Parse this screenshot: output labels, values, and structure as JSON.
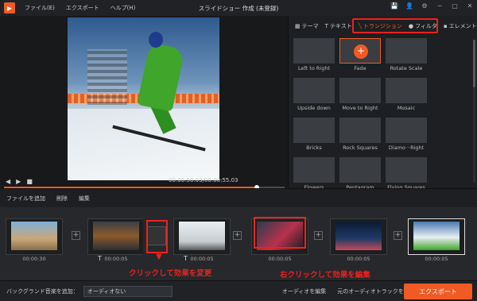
{
  "titlebar": {
    "logo": "▶",
    "menu": [
      "ファイル(E)",
      "エクスポート",
      "ヘルプ(H)"
    ],
    "title": "スライドショー 作成 (未登録)",
    "controls": [
      "💾",
      "👤",
      "⚙",
      "─",
      "▢",
      "✕"
    ]
  },
  "preview": {
    "progress_fraction": 0.9,
    "timecode": "00:00:50.03/00:00:55.03",
    "buttons": [
      "◀",
      "▶",
      "■"
    ],
    "right_icons": [
      "⊞",
      "◀",
      "⛶"
    ]
  },
  "panel": {
    "tabs": [
      {
        "icon": "▦",
        "label": "テーマ"
      },
      {
        "icon": "T",
        "label": "テキスト"
      },
      {
        "icon": "╲",
        "label": "トランジション"
      },
      {
        "icon": "●",
        "label": "フィルタ"
      },
      {
        "icon": "▪",
        "label": "エレメント"
      }
    ],
    "transitions": [
      {
        "label": "Left to Right"
      },
      {
        "label": "Fade"
      },
      {
        "label": "Rotate Scale"
      },
      {
        "label": "Upside down"
      },
      {
        "label": "Move to Right"
      },
      {
        "label": "Mosaic"
      },
      {
        "label": "Bricks"
      },
      {
        "label": "Rock Squares"
      },
      {
        "label": "Diamo···Right"
      },
      {
        "label": "Flowers"
      },
      {
        "label": "Pentagram"
      },
      {
        "label": "Flying Squares"
      }
    ]
  },
  "toolbar": {
    "add_files": "ファイルを追加",
    "delete": "削除",
    "edit": "編集"
  },
  "timeline": {
    "clips": [
      {
        "duration": "00:00:30"
      },
      {
        "duration": "00:00:05"
      },
      {
        "duration": "00:00:05"
      },
      {
        "duration": "00:00:05"
      },
      {
        "duration": "00:00:05"
      },
      {
        "duration": "00:00:05"
      }
    ],
    "annotation_left": "クリックして効果を変更",
    "annotation_right": "右クリックして効果を編集"
  },
  "bottombar": {
    "bgm_label": "バックグランド音楽を追加：",
    "bgm_value": "オーディオない",
    "edit_audio": "オーディオを編集",
    "keep_original": "元のオーディオトラックを保存する",
    "export": "エクスポート"
  }
}
